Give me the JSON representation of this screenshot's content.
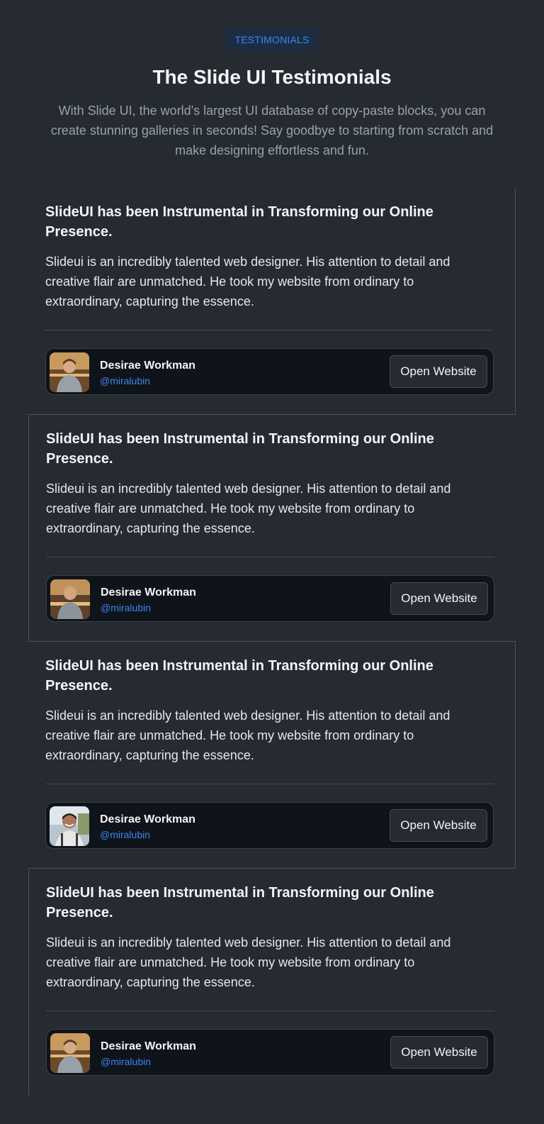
{
  "header": {
    "badge": "TESTIMONIALS",
    "title": "The Slide UI Testimonials",
    "subtitle": "With Slide UI, the world's largest UI database of copy-paste blocks, you can create stunning galleries in seconds! Say goodbye to starting from scratch and make designing effortless and fun."
  },
  "testimonials": [
    {
      "title": "SlideUI has been Instrumental in Transforming our Online Presence.",
      "body": "Slideui is an incredibly talented web designer. His attention to detail and creative flair are unmatched. He took my website from ordinary to extraordinary, capturing the essence.",
      "author_name": "Desirae Workman",
      "author_handle": "@miralubin",
      "button_label": "Open Website",
      "avatar_icon": "person-photo"
    },
    {
      "title": "SlideUI has been Instrumental in Transforming our Online Presence.",
      "body": "Slideui is an incredibly talented web designer. His attention to detail and creative flair are unmatched. He took my website from ordinary to extraordinary, capturing the essence.",
      "author_name": "Desirae Workman",
      "author_handle": "@miralubin",
      "button_label": "Open Website",
      "avatar_icon": "person-photo"
    },
    {
      "title": "SlideUI has been Instrumental in Transforming our Online Presence.",
      "body": "Slideui is an incredibly talented web designer. His attention to detail and creative flair are unmatched. He took my website from ordinary to extraordinary, capturing the essence.",
      "author_name": "Desirae Workman",
      "author_handle": "@miralubin",
      "button_label": "Open Website",
      "avatar_icon": "person-photo"
    },
    {
      "title": "SlideUI has been Instrumental in Transforming our Online Presence.",
      "body": "Slideui is an incredibly talented web designer. His attention to detail and creative flair are unmatched. He took my website from ordinary to extraordinary, capturing the essence.",
      "author_name": "Desirae Workman",
      "author_handle": "@miralubin",
      "button_label": "Open Website",
      "avatar_icon": "person-photo"
    }
  ],
  "colors": {
    "background": "#262b32",
    "accent": "#3b86f0",
    "author_panel": "#0f131a"
  }
}
